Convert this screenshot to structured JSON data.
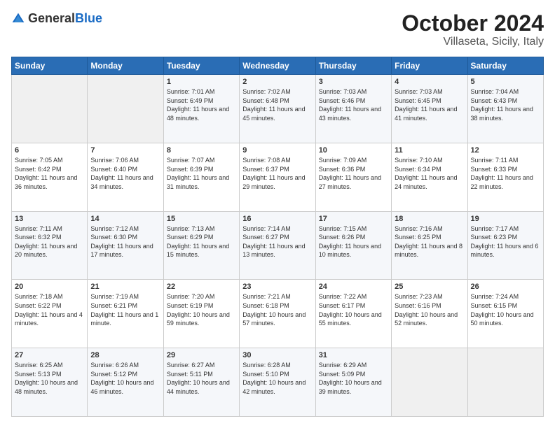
{
  "header": {
    "logo_general": "General",
    "logo_blue": "Blue",
    "month": "October 2024",
    "location": "Villaseta, Sicily, Italy"
  },
  "days_of_week": [
    "Sunday",
    "Monday",
    "Tuesday",
    "Wednesday",
    "Thursday",
    "Friday",
    "Saturday"
  ],
  "weeks": [
    [
      {
        "day": "",
        "sunrise": "",
        "sunset": "",
        "daylight": "",
        "empty": true
      },
      {
        "day": "",
        "sunrise": "",
        "sunset": "",
        "daylight": "",
        "empty": true
      },
      {
        "day": "1",
        "sunrise": "Sunrise: 7:01 AM",
        "sunset": "Sunset: 6:49 PM",
        "daylight": "Daylight: 11 hours and 48 minutes."
      },
      {
        "day": "2",
        "sunrise": "Sunrise: 7:02 AM",
        "sunset": "Sunset: 6:48 PM",
        "daylight": "Daylight: 11 hours and 45 minutes."
      },
      {
        "day": "3",
        "sunrise": "Sunrise: 7:03 AM",
        "sunset": "Sunset: 6:46 PM",
        "daylight": "Daylight: 11 hours and 43 minutes."
      },
      {
        "day": "4",
        "sunrise": "Sunrise: 7:03 AM",
        "sunset": "Sunset: 6:45 PM",
        "daylight": "Daylight: 11 hours and 41 minutes."
      },
      {
        "day": "5",
        "sunrise": "Sunrise: 7:04 AM",
        "sunset": "Sunset: 6:43 PM",
        "daylight": "Daylight: 11 hours and 38 minutes."
      }
    ],
    [
      {
        "day": "6",
        "sunrise": "Sunrise: 7:05 AM",
        "sunset": "Sunset: 6:42 PM",
        "daylight": "Daylight: 11 hours and 36 minutes."
      },
      {
        "day": "7",
        "sunrise": "Sunrise: 7:06 AM",
        "sunset": "Sunset: 6:40 PM",
        "daylight": "Daylight: 11 hours and 34 minutes."
      },
      {
        "day": "8",
        "sunrise": "Sunrise: 7:07 AM",
        "sunset": "Sunset: 6:39 PM",
        "daylight": "Daylight: 11 hours and 31 minutes."
      },
      {
        "day": "9",
        "sunrise": "Sunrise: 7:08 AM",
        "sunset": "Sunset: 6:37 PM",
        "daylight": "Daylight: 11 hours and 29 minutes."
      },
      {
        "day": "10",
        "sunrise": "Sunrise: 7:09 AM",
        "sunset": "Sunset: 6:36 PM",
        "daylight": "Daylight: 11 hours and 27 minutes."
      },
      {
        "day": "11",
        "sunrise": "Sunrise: 7:10 AM",
        "sunset": "Sunset: 6:34 PM",
        "daylight": "Daylight: 11 hours and 24 minutes."
      },
      {
        "day": "12",
        "sunrise": "Sunrise: 7:11 AM",
        "sunset": "Sunset: 6:33 PM",
        "daylight": "Daylight: 11 hours and 22 minutes."
      }
    ],
    [
      {
        "day": "13",
        "sunrise": "Sunrise: 7:11 AM",
        "sunset": "Sunset: 6:32 PM",
        "daylight": "Daylight: 11 hours and 20 minutes."
      },
      {
        "day": "14",
        "sunrise": "Sunrise: 7:12 AM",
        "sunset": "Sunset: 6:30 PM",
        "daylight": "Daylight: 11 hours and 17 minutes."
      },
      {
        "day": "15",
        "sunrise": "Sunrise: 7:13 AM",
        "sunset": "Sunset: 6:29 PM",
        "daylight": "Daylight: 11 hours and 15 minutes."
      },
      {
        "day": "16",
        "sunrise": "Sunrise: 7:14 AM",
        "sunset": "Sunset: 6:27 PM",
        "daylight": "Daylight: 11 hours and 13 minutes."
      },
      {
        "day": "17",
        "sunrise": "Sunrise: 7:15 AM",
        "sunset": "Sunset: 6:26 PM",
        "daylight": "Daylight: 11 hours and 10 minutes."
      },
      {
        "day": "18",
        "sunrise": "Sunrise: 7:16 AM",
        "sunset": "Sunset: 6:25 PM",
        "daylight": "Daylight: 11 hours and 8 minutes."
      },
      {
        "day": "19",
        "sunrise": "Sunrise: 7:17 AM",
        "sunset": "Sunset: 6:23 PM",
        "daylight": "Daylight: 11 hours and 6 minutes."
      }
    ],
    [
      {
        "day": "20",
        "sunrise": "Sunrise: 7:18 AM",
        "sunset": "Sunset: 6:22 PM",
        "daylight": "Daylight: 11 hours and 4 minutes."
      },
      {
        "day": "21",
        "sunrise": "Sunrise: 7:19 AM",
        "sunset": "Sunset: 6:21 PM",
        "daylight": "Daylight: 11 hours and 1 minute."
      },
      {
        "day": "22",
        "sunrise": "Sunrise: 7:20 AM",
        "sunset": "Sunset: 6:19 PM",
        "daylight": "Daylight: 10 hours and 59 minutes."
      },
      {
        "day": "23",
        "sunrise": "Sunrise: 7:21 AM",
        "sunset": "Sunset: 6:18 PM",
        "daylight": "Daylight: 10 hours and 57 minutes."
      },
      {
        "day": "24",
        "sunrise": "Sunrise: 7:22 AM",
        "sunset": "Sunset: 6:17 PM",
        "daylight": "Daylight: 10 hours and 55 minutes."
      },
      {
        "day": "25",
        "sunrise": "Sunrise: 7:23 AM",
        "sunset": "Sunset: 6:16 PM",
        "daylight": "Daylight: 10 hours and 52 minutes."
      },
      {
        "day": "26",
        "sunrise": "Sunrise: 7:24 AM",
        "sunset": "Sunset: 6:15 PM",
        "daylight": "Daylight: 10 hours and 50 minutes."
      }
    ],
    [
      {
        "day": "27",
        "sunrise": "Sunrise: 6:25 AM",
        "sunset": "Sunset: 5:13 PM",
        "daylight": "Daylight: 10 hours and 48 minutes."
      },
      {
        "day": "28",
        "sunrise": "Sunrise: 6:26 AM",
        "sunset": "Sunset: 5:12 PM",
        "daylight": "Daylight: 10 hours and 46 minutes."
      },
      {
        "day": "29",
        "sunrise": "Sunrise: 6:27 AM",
        "sunset": "Sunset: 5:11 PM",
        "daylight": "Daylight: 10 hours and 44 minutes."
      },
      {
        "day": "30",
        "sunrise": "Sunrise: 6:28 AM",
        "sunset": "Sunset: 5:10 PM",
        "daylight": "Daylight: 10 hours and 42 minutes."
      },
      {
        "day": "31",
        "sunrise": "Sunrise: 6:29 AM",
        "sunset": "Sunset: 5:09 PM",
        "daylight": "Daylight: 10 hours and 39 minutes."
      },
      {
        "day": "",
        "sunrise": "",
        "sunset": "",
        "daylight": "",
        "empty": true
      },
      {
        "day": "",
        "sunrise": "",
        "sunset": "",
        "daylight": "",
        "empty": true
      }
    ]
  ]
}
